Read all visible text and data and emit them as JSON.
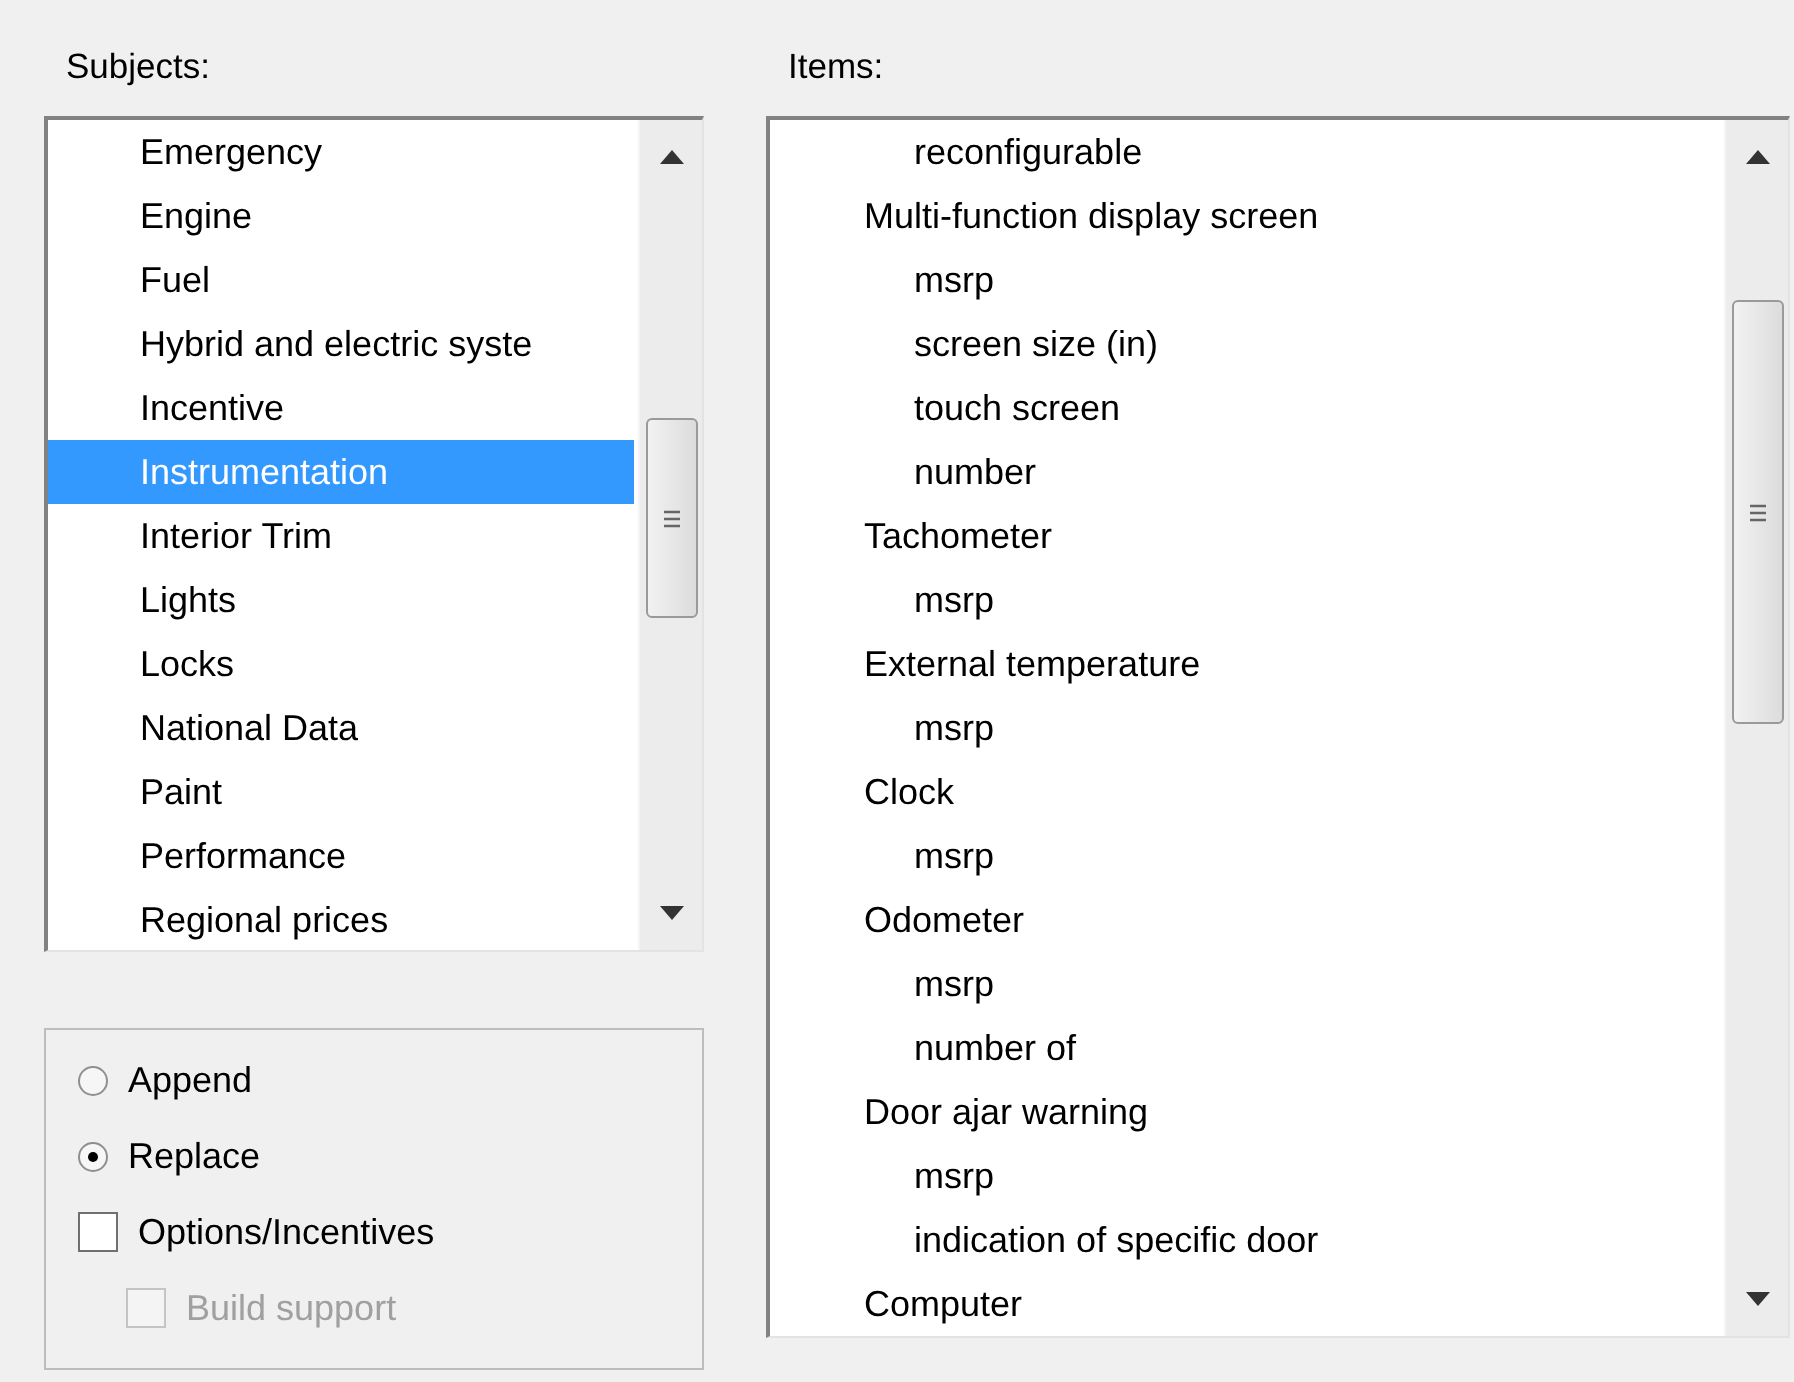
{
  "subjects": {
    "label": "Subjects:",
    "items": [
      {
        "label": "Emergency",
        "selected": false
      },
      {
        "label": "Engine",
        "selected": false
      },
      {
        "label": "Fuel",
        "selected": false
      },
      {
        "label": "Hybrid and electric syste",
        "selected": false
      },
      {
        "label": "Incentive",
        "selected": false
      },
      {
        "label": "Instrumentation",
        "selected": true
      },
      {
        "label": "Interior Trim",
        "selected": false
      },
      {
        "label": "Lights",
        "selected": false
      },
      {
        "label": "Locks",
        "selected": false
      },
      {
        "label": "National Data",
        "selected": false
      },
      {
        "label": "Paint",
        "selected": false
      },
      {
        "label": "Performance",
        "selected": false
      },
      {
        "label": "Regional prices",
        "selected": false
      }
    ]
  },
  "mode": [
    {
      "label": "Append",
      "selected": false
    },
    {
      "label": "Replace",
      "selected": true
    }
  ],
  "checkboxes": [
    {
      "label": "Options/Incentives",
      "checked": false,
      "disabled": false,
      "children": [
        {
          "label": "Build support",
          "checked": false,
          "disabled": true
        }
      ]
    }
  ],
  "items": {
    "label": "Items:",
    "entries": [
      {
        "children": [
          {
            "label": "reconfigurable"
          }
        ]
      },
      {
        "label": "Multi-function display screen",
        "children": [
          {
            "label": "msrp"
          },
          {
            "label": "screen size (in)"
          },
          {
            "label": "touch screen"
          },
          {
            "label": "number"
          }
        ]
      },
      {
        "label": "Tachometer",
        "children": [
          {
            "label": "msrp"
          }
        ]
      },
      {
        "label": "External temperature",
        "children": [
          {
            "label": "msrp"
          }
        ]
      },
      {
        "label": "Clock",
        "children": [
          {
            "label": "msrp"
          }
        ]
      },
      {
        "label": "Odometer",
        "children": [
          {
            "label": "msrp"
          },
          {
            "label": "number of"
          }
        ]
      },
      {
        "label": "Door ajar warning",
        "children": [
          {
            "label": "msrp"
          },
          {
            "label": "indication of specific door"
          }
        ]
      },
      {
        "label": "Computer"
      }
    ]
  }
}
